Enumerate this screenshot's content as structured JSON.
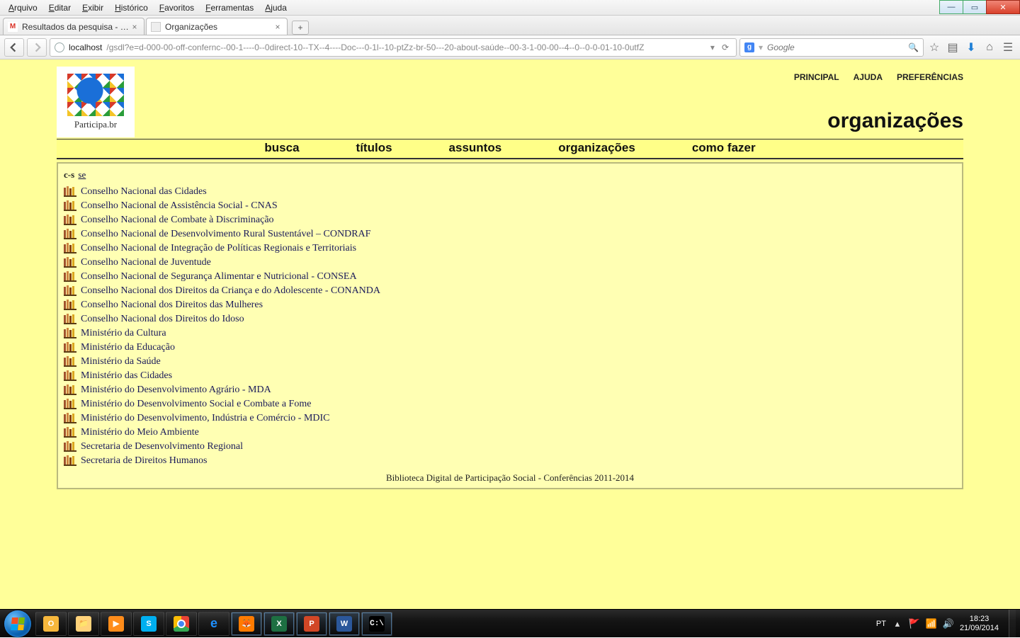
{
  "browser": {
    "menus": [
      "Arquivo",
      "Editar",
      "Exibir",
      "Histórico",
      "Favoritos",
      "Ferramentas",
      "Ajuda"
    ],
    "tabs": [
      {
        "title": "Resultados da pesquisa - ef...",
        "active": false
      },
      {
        "title": "Organizações",
        "active": true
      }
    ],
    "url_host": "localhost",
    "url_path": "/gsdl?e=d-000-00-off-confernc--00-1----0--0direct-10--TX--4----Doc---0-1l--10-ptZz-br-50---20-about-saúde--00-3-1-00-00--4--0--0-0-01-10-0utfZ",
    "search_placeholder": "Google"
  },
  "page": {
    "logo_text": "Participa.br",
    "top_links": [
      "PRINCIPAL",
      "AJUDA",
      "PREFERÊNCIAS"
    ],
    "title": "organizações",
    "nav_tabs": [
      "busca",
      "títulos",
      "assuntos",
      "organizações",
      "como fazer"
    ],
    "alpha_current": "c-s",
    "alpha_link": "se",
    "organizations": [
      "Conselho Nacional das Cidades",
      "Conselho Nacional de Assistência Social - CNAS",
      "Conselho Nacional de Combate à Discriminação",
      "Conselho Nacional de Desenvolvimento Rural Sustentável – CONDRAF",
      "Conselho Nacional de Integração de Políticas Regionais e Territoriais",
      "Conselho Nacional de Juventude",
      "Conselho Nacional de Segurança Alimentar e Nutricional - CONSEA",
      "Conselho Nacional dos Direitos da Criança e do Adolescente - CONANDA",
      "Conselho Nacional dos Direitos das Mulheres",
      "Conselho Nacional dos Direitos do Idoso",
      "Ministério da Cultura",
      "Ministério da Educação",
      "Ministério da Saúde",
      "Ministério das Cidades",
      "Ministério do Desenvolvimento Agrário - MDA",
      "Ministério do Desenvolvimento Social e Combate a Fome",
      "Ministério do Desenvolvimento, Indústria e Comércio - MDIC",
      "Ministério do Meio Ambiente",
      "Secretaria de Desenvolvimento Regional",
      "Secretaria de Direitos Humanos"
    ],
    "footer": "Biblioteca Digital de Participação Social - Conferências 2011-2014"
  },
  "taskbar": {
    "lang": "PT",
    "time": "18:23",
    "date": "21/09/2014"
  }
}
